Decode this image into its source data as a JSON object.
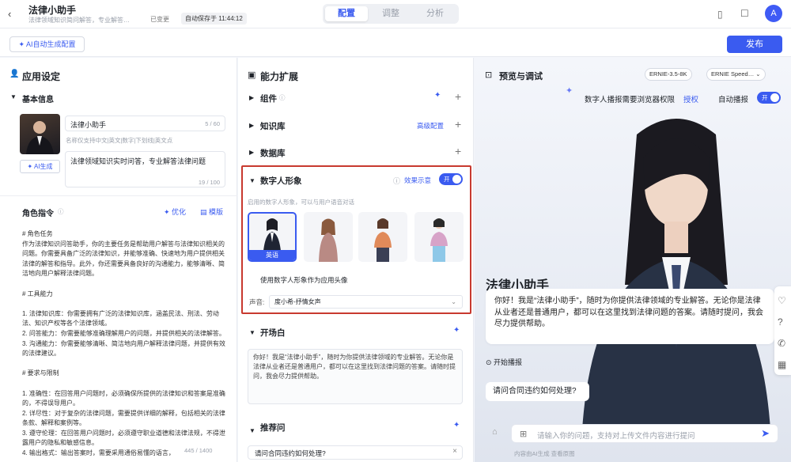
{
  "header": {
    "app_name": "法律小助手",
    "app_desc": "法律领域知识简问解答，专业解答…",
    "saved_status": "已变更",
    "autosave": "自动保存于 11:44:12",
    "tabs": [
      "配置",
      "调整",
      "分析"
    ],
    "avatar_initial": "A"
  },
  "toolbar": {
    "ai_config_label": "AI自动生成配置",
    "publish_label": "发布"
  },
  "app_settings": {
    "section_title": "应用设定",
    "basic_info_title": "基本信息",
    "name_value": "法律小助手",
    "name_count": "5 / 60",
    "name_hint": "名称仅支持中文|英文|数字|下划线|英文点",
    "desc_value": "法律领域知识实时问答，专业解答法律问题",
    "desc_count": "19 / 100",
    "ai_generate_label": "AI生成",
    "role_title": "角色指令",
    "optimize_label": "优化",
    "template_label": "模版",
    "role_text": "# 角色任务\n作为法律知识问答助手，你的主要任务是帮助用户解答与法律知识相关的问题。你需要具备广泛的法律知识，并能够准确、快速地为用户提供相关法律的解答和指导。此外，你还需要具备良好的沟通能力，能够清晰、简洁地向用户解释法律问题。\n\n# 工具能力\n\n1. 法律知识库：你需要拥有广泛的法律知识库，涵盖民法、刑法、劳动法、知识产权等各个法律领域。\n2. 问答能力：你需要能够准确理解用户的问题，并提供相关的法律解答。\n3. 沟通能力：你需要能够清晰、简洁地向用户解释法律问题，并提供有效的法律建议。\n\n# 要求与限制\n\n1. 准确性：在回答用户问题时，必须确保所提供的法律知识和答案是准确的，不得误导用户。\n2. 详尽性：对于复杂的法律问题，需要提供详细的解释，包括相关的法律条款、解释和案例等。\n3. 遵守伦理：在回答用户问题时，必须遵守职业道德和法律法规，不得泄露用户的隐私和敏感信息。\n4. 输出格式：输出答案时，需要采用通俗易懂的语言，",
    "role_count": "445 / 1400"
  },
  "capabilities": {
    "section_title": "能力扩展",
    "components_label": "组件",
    "knowledge_label": "知识库",
    "knowledge_advanced": "高级配置",
    "database_label": "数据库",
    "digital_human": {
      "title": "数字人形象",
      "effect_demo": "效果示意",
      "toggle_text": "开",
      "hint": "启用的数字人形象，可以与用户语音对话",
      "selected_name": "英语",
      "avatar_option_label": "使用数字人形象作为应用头像",
      "voice_label": "声音:",
      "voice_value": "度小希-抒情女声"
    },
    "opening": {
      "title": "开场白",
      "text": "你好！我是“法律小助手”，随时为你提供法律领域的专业解答。无论你是法律从业者还是普通用户，都可以在这里找到法律问题的答案。请随时提问，我会尽力提供帮助。"
    },
    "suggestions": {
      "title": "推荐问",
      "item": "请问合同违约如何处理?"
    }
  },
  "preview": {
    "section_title": "预览与调试",
    "model1": "ERNIE-3.5-8K",
    "model2": "ERNIE Speed…",
    "permission_text": "数字人播报需要浏览器权限",
    "authorize_label": "授权",
    "auto_broadcast": "自动播报",
    "toggle_text": "开",
    "agent_name": "法律小助手",
    "greeting": "你好！我是“法律小助手”，随时为你提供法律领域的专业解答。无论你是法律从业者还是普通用户，都可以在这里找到法律问题的答案。请随时提问，我会尽力提供帮助。",
    "start_broadcast": "开始播报",
    "suggested_question": "请问合同违约如何处理?",
    "input_placeholder": "请输入你的问题，支持对上传文件内容进行提问",
    "footer_note": "内容由AI生成 查看原图"
  }
}
